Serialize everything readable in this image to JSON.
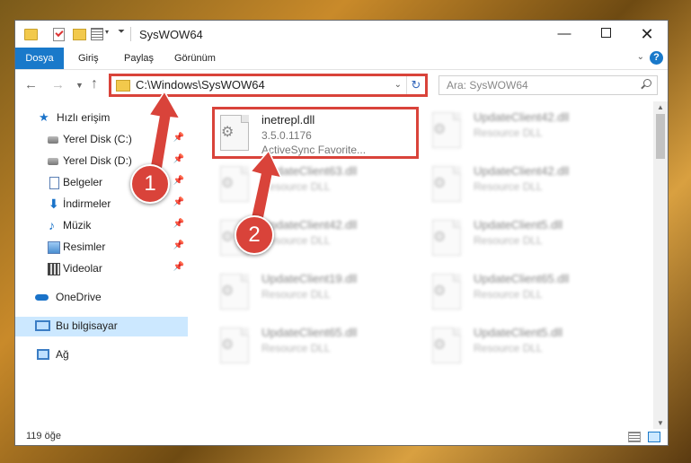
{
  "window": {
    "title": "SysWOW64",
    "min_glyph": "—",
    "close_glyph": "✕"
  },
  "ribbon": {
    "tabs": [
      "Dosya",
      "Giriş",
      "Paylaş",
      "Görünüm"
    ],
    "help": "?"
  },
  "address": {
    "path": "C:\\Windows\\SysWOW64",
    "search_placeholder": "Ara: SysWOW64"
  },
  "sidebar": {
    "items": [
      {
        "label": "Hızlı erişim",
        "icon": "star-icon"
      },
      {
        "label": "Yerel Disk (C:)",
        "icon": "disk-icon"
      },
      {
        "label": "Yerel Disk (D:)",
        "icon": "disk-icon"
      },
      {
        "label": "Belgeler",
        "icon": "document-icon"
      },
      {
        "label": "İndirmeler",
        "icon": "download-icon"
      },
      {
        "label": "Müzik",
        "icon": "music-icon"
      },
      {
        "label": "Resimler",
        "icon": "pictures-icon"
      },
      {
        "label": "Videolar",
        "icon": "video-icon"
      },
      {
        "label": "OneDrive",
        "icon": "cloud-icon"
      },
      {
        "label": "Bu bilgisayar",
        "icon": "computer-icon"
      },
      {
        "label": "Ağ",
        "icon": "network-icon"
      }
    ]
  },
  "files": [
    {
      "name": "inetrepl.dll",
      "meta1": "3.5.0.1176",
      "meta2": "ActiveSync Favorite..."
    },
    {
      "name": "UpdateClient42.dll",
      "meta1": "Resource DLL"
    },
    {
      "name": "UpdateClient63.dll",
      "meta1": "Resource DLL"
    },
    {
      "name": "UpdateClient42.dll",
      "meta1": "Resource DLL"
    },
    {
      "name": "UpdateClient42.dll",
      "meta1": "Resource DLL"
    },
    {
      "name": "UpdateClient5.dll",
      "meta1": "Resource DLL"
    },
    {
      "name": "UpdateClient19.dll",
      "meta1": "Resource DLL"
    },
    {
      "name": "UpdateClient65.dll",
      "meta1": "Resource DLL"
    },
    {
      "name": "UpdateClient65.dll",
      "meta1": "Resource DLL"
    },
    {
      "name": "UpdateClient5.dll",
      "meta1": "Resource DLL"
    }
  ],
  "status": {
    "count": "119 öğe"
  },
  "annotations": {
    "step1": "1",
    "step2": "2",
    "color": "#d9433a"
  }
}
